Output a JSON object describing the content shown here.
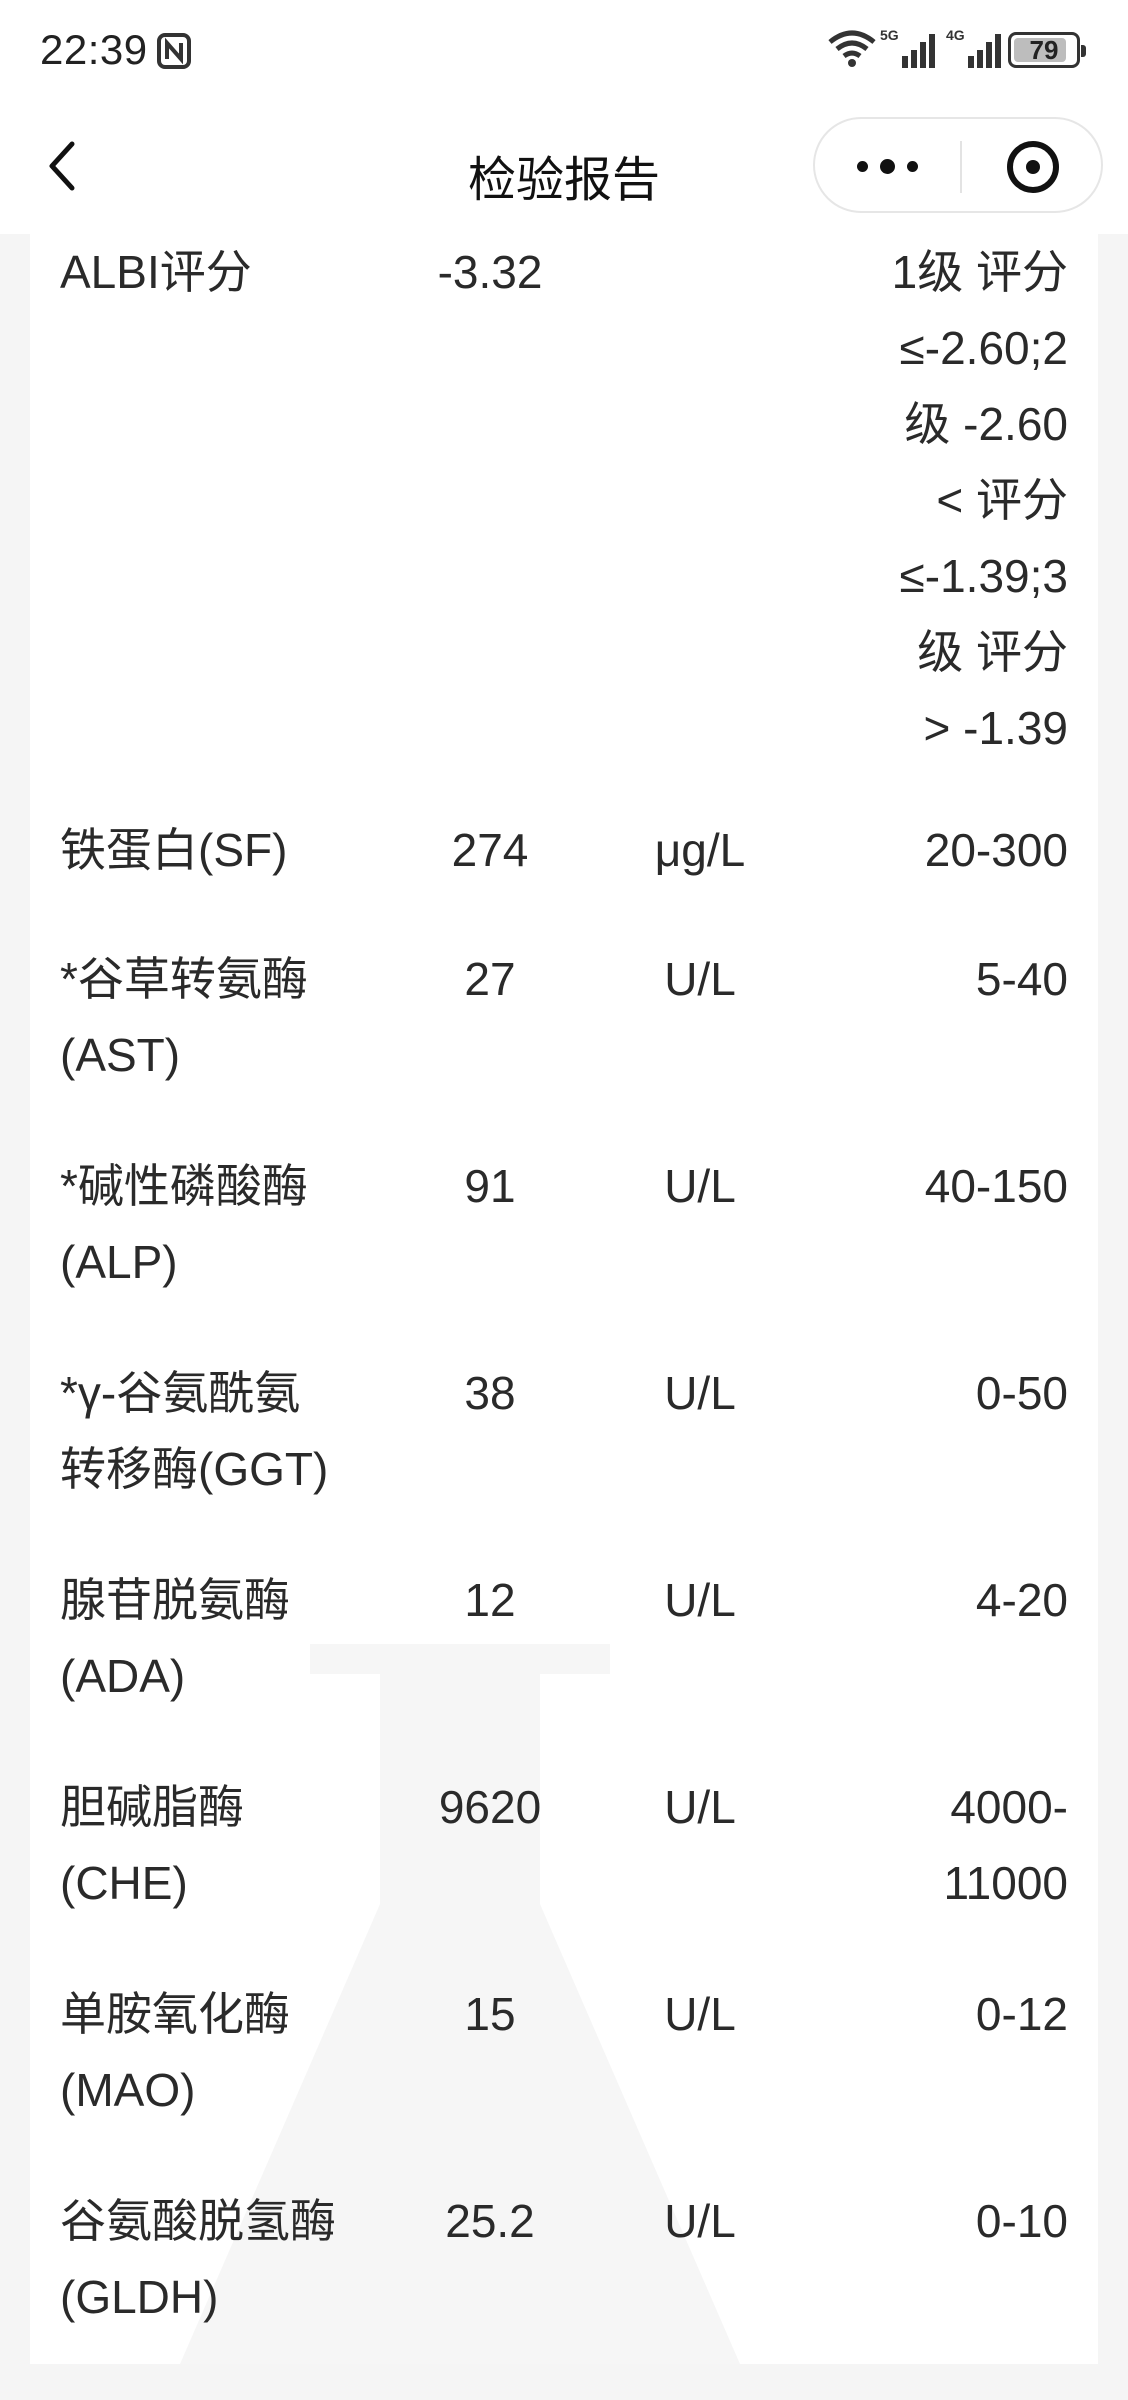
{
  "status_bar": {
    "time": "22:39",
    "battery": "79",
    "network_5g": "5G",
    "network_4g": "4G",
    "icons": [
      "nfc-icon",
      "wifi-icon",
      "signal-5g-icon",
      "signal-4g-icon",
      "battery-icon"
    ]
  },
  "nav": {
    "title": "检验报告",
    "back_icon": "chevron-left-icon",
    "more_icon": "more-dots-icon",
    "close_icon": "target-circle-icon"
  },
  "rows": [
    {
      "name": "ALBI评分",
      "value": "-3.32",
      "unit": "",
      "range": "1级 评分\n≤-2.60;2\n级 -2.60\n< 评分\n≤-1.39;3\n级 评分\n> -1.39"
    },
    {
      "name": "铁蛋白(SF)",
      "value": "274",
      "unit": "μg/L",
      "range": "20-300"
    },
    {
      "name": "*谷草转氨酶\n(AST)",
      "value": "27",
      "unit": "U/L",
      "range": "5-40"
    },
    {
      "name": "*碱性磷酸酶\n(ALP)",
      "value": "91",
      "unit": "U/L",
      "range": "40-150"
    },
    {
      "name": "*γ-谷氨酰氨\n转移酶(GGT)",
      "value": "38",
      "unit": "U/L",
      "range": "0-50"
    },
    {
      "name": "腺苷脱氨酶\n(ADA)",
      "value": "12",
      "unit": "U/L",
      "range": "4-20"
    },
    {
      "name": "胆碱脂酶\n(CHE)",
      "value": "9620",
      "unit": "U/L",
      "range": "4000-\n11000"
    },
    {
      "name": "单胺氧化酶\n(MAO)",
      "value": "15",
      "unit": "U/L",
      "range": "0-12"
    },
    {
      "name": "谷氨酸脱氢酶\n(GLDH)",
      "value": "25.2",
      "unit": "U/L",
      "range": "0-10"
    }
  ],
  "colors": {
    "background": "#f5f5f5",
    "card": "#ffffff",
    "text": "#2a2a2a",
    "watermark": "#f4f4f4"
  }
}
